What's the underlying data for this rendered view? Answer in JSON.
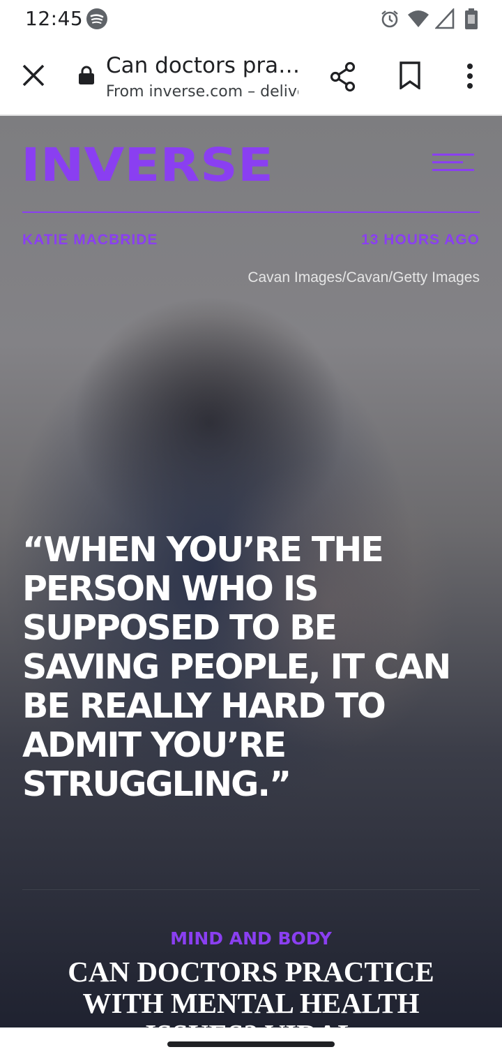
{
  "status_bar": {
    "time": "12:45",
    "icons": [
      "spotify-icon",
      "alarm-icon",
      "wifi-icon",
      "signal-icon",
      "battery-icon"
    ]
  },
  "toolbar": {
    "title": "Can doctors practice with mental health issues? Viral",
    "url": "From inverse.com – delivered by Google",
    "icons": [
      "close-icon",
      "lock-icon",
      "share-icon",
      "bookmark-icon",
      "more-vert-icon"
    ]
  },
  "article": {
    "brand": "INVERSE",
    "author": "KATIE MACBRIDE",
    "time_ago": "13 HOURS AGO",
    "image_credit": "Cavan Images/Cavan/Getty Images",
    "quote": "“When you’re the person who is supposed to be saving people, it can be really hard to admit you’re struggling.”",
    "category": "MIND AND BODY",
    "headline": "Can doctors practice with mental health issues? Viral"
  },
  "colors": {
    "accent": "#8a3ff1",
    "quote_text": "#ffffff",
    "toolbar_bg": "#ffffff"
  }
}
